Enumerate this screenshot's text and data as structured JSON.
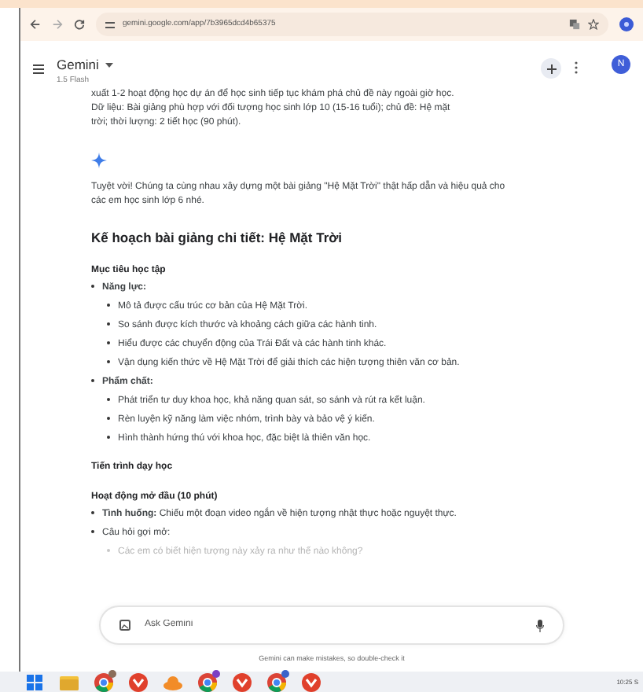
{
  "browser": {
    "url": "gemini.google.com/app/7b3965dcd4b65375"
  },
  "header": {
    "title": "Gemini",
    "model": "1.5 Flash",
    "avatar": "N"
  },
  "blocks": [
    {
      "kind": "paragraph",
      "text": "xuất 1-2 hoạt động học dự án để học sinh tiếp tục khám phá chủ đề này ngoài giờ học.\nDữ liệu: Bài giảng phù hợp với đối tượng học sinh lớp 10 (15-16 tuổi); chủ đề: Hệ mặt\ntrời; thời lượng: 2 tiết học (90 phút)."
    },
    {
      "kind": "spark"
    },
    {
      "kind": "paragraph",
      "text": "Tuyệt vời! Chúng ta cùng nhau xây dựng một bài giảng \"Hệ Mặt Trời\" thật hấp dẫn và hiệu quả cho\ncác em học sinh lớp 6 nhé."
    },
    {
      "kind": "heading",
      "text": "Kế hoạch bài giảng chi tiết: Hệ Mặt Trời"
    },
    {
      "kind": "subheading",
      "text": "Mục tiêu học tập"
    },
    {
      "kind": "list",
      "items": [
        {
          "text": "**Năng lực:**",
          "children": [
            {
              "text": "Mô tả được cấu trúc cơ bản của Hệ Mặt Trời."
            },
            {
              "text": "So sánh được kích thước và khoảng cách giữa các hành tinh."
            },
            {
              "text": "Hiểu được các chuyển động của Trái Đất và các hành tinh khác."
            },
            {
              "text": "Vận dụng kiến thức về Hệ Mặt Trời để giải thích các hiện tượng thiên văn cơ bản."
            }
          ]
        },
        {
          "text": "**Phẩm chất:**",
          "children": [
            {
              "text": "Phát triển tư duy khoa học, khả năng quan sát, so sánh và rút ra kết luận."
            },
            {
              "text": "Rèn luyện kỹ năng làm việc nhóm, trình bày và bảo vệ ý kiến."
            },
            {
              "text": "Hình thành hứng thú với khoa học, đặc biệt là thiên văn học."
            }
          ]
        }
      ]
    },
    {
      "kind": "subheading",
      "text": "Tiến trình dạy học"
    },
    {
      "kind": "subheading",
      "text": "Hoạt động mở đầu (10 phút)"
    },
    {
      "kind": "list",
      "items": [
        {
          "text": "**Tình huống:** Chiếu một đoạn video ngắn về hiện tượng nhật thực hoặc nguyệt thực."
        },
        {
          "text": "Câu hỏi gợi mở:",
          "children": [
            {
              "text": "Các em có biết hiện tượng này xảy ra như thế nào không?",
              "faded": true
            }
          ]
        }
      ]
    }
  ],
  "input": {
    "placeholder": "Ask Gemini"
  },
  "disclaimer": "Gemini can make mistakes, so double-check it",
  "taskbar": {
    "apps": [
      {
        "kind": "windows"
      },
      {
        "kind": "folder"
      },
      {
        "kind": "chrome",
        "color": "#8a6d5a"
      },
      {
        "kind": "red"
      },
      {
        "kind": "cloud"
      },
      {
        "kind": "chrome",
        "color": "#7b3fc4"
      },
      {
        "kind": "red"
      },
      {
        "kind": "chrome",
        "color": "#3a62c9"
      },
      {
        "kind": "red"
      }
    ],
    "clock": "10:25 S"
  }
}
